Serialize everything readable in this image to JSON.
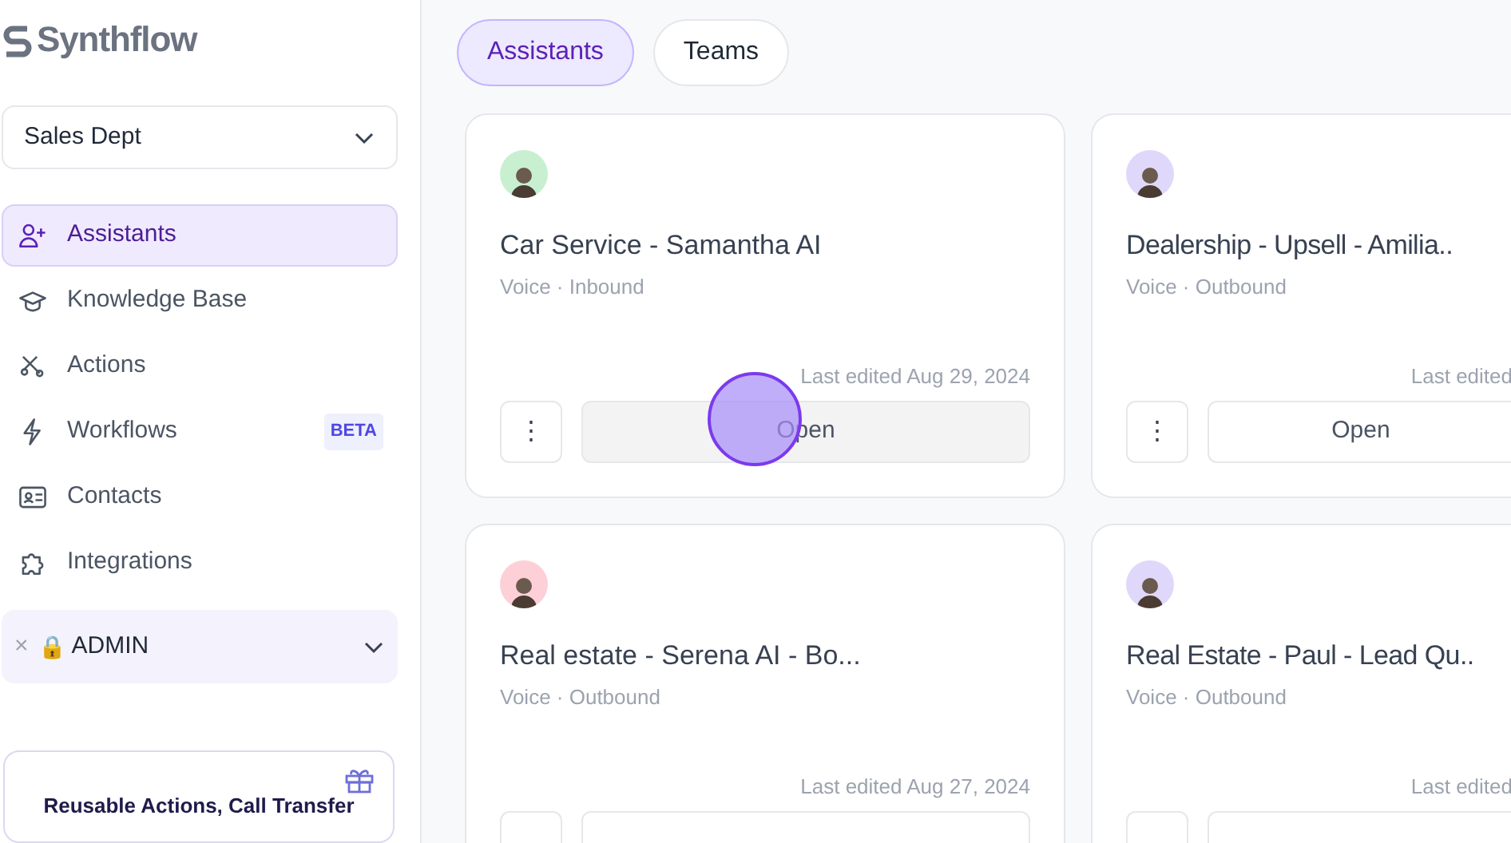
{
  "sidebar": {
    "logo": "Synthflow",
    "workspace": "Sales Dept",
    "items": [
      {
        "label": "Assistants",
        "selected": true
      },
      {
        "label": "Knowledge Base",
        "selected": false
      },
      {
        "label": "Actions",
        "selected": false
      },
      {
        "label": "Workflows",
        "selected": false,
        "badge": "BETA"
      },
      {
        "label": "Contacts",
        "selected": false
      },
      {
        "label": "Integrations",
        "selected": false
      }
    ],
    "admin": {
      "close": "×",
      "lock": "🔒",
      "label": "ADMIN"
    },
    "promo": {
      "text": "Reusable Actions, Call Transfer"
    }
  },
  "tabs": [
    {
      "label": "Assistants",
      "selected": true
    },
    {
      "label": "Teams",
      "selected": false
    }
  ],
  "cards": [
    {
      "name": "Car Service - Samantha AI",
      "meta": "Voice · Inbound",
      "edited": "Last edited Aug 29, 2024",
      "open": "Open",
      "menu": "⋮",
      "color": "#c8f0d0",
      "hovered": true
    },
    {
      "name": "Dealership - Upsell - Amilia..",
      "meta": "Voice · Outbound",
      "edited": "Last edited",
      "open": "Open",
      "menu": "⋮",
      "color": "#e0d8fa",
      "hovered": false
    },
    {
      "name": "Real estate - Serena AI - Bo...",
      "meta": "Voice · Outbound",
      "edited": "Last edited Aug 27, 2024",
      "color": "#fcd0d6"
    },
    {
      "name": "Real Estate - Paul - Lead Qu..",
      "meta": "Voice · Outbound",
      "edited": "Last edited",
      "color": "#e0d8fa"
    }
  ]
}
